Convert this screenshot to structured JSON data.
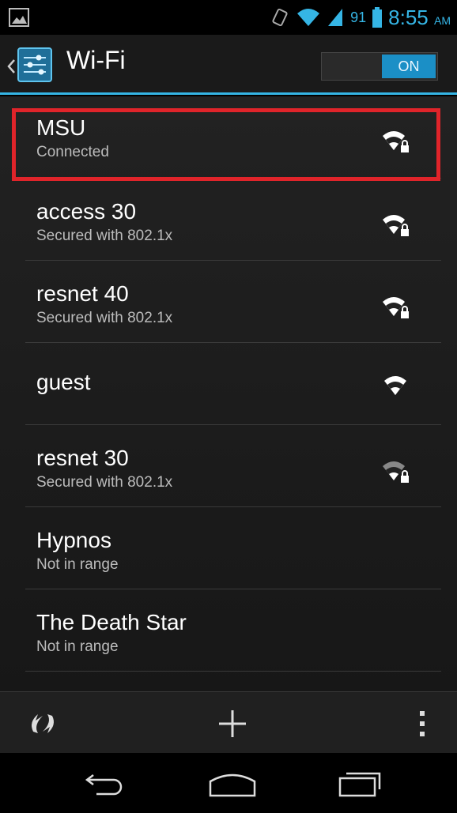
{
  "status_bar": {
    "battery_percent": "91",
    "time": "8:55",
    "ampm": "AM",
    "icons": [
      "gallery-notification-icon",
      "vibrate-icon",
      "wifi-status-icon",
      "signal-icon",
      "battery-icon"
    ]
  },
  "action_bar": {
    "title": "Wi-Fi",
    "toggle_label": "ON",
    "icons": [
      "back-chevron-icon",
      "settings-app-icon"
    ]
  },
  "networks": [
    {
      "ssid": "MSU",
      "status": "Connected",
      "icon": "wifi-secured-icon",
      "highlighted": true
    },
    {
      "ssid": "access 30",
      "status": "Secured with 802.1x",
      "icon": "wifi-secured-icon"
    },
    {
      "ssid": "resnet 40",
      "status": "Secured with 802.1x",
      "icon": "wifi-secured-icon"
    },
    {
      "ssid": "guest",
      "status": "",
      "icon": "wifi-open-icon"
    },
    {
      "ssid": "resnet 30",
      "status": "Secured with 802.1x",
      "icon": "wifi-secured-weak-icon"
    },
    {
      "ssid": "Hypnos",
      "status": "Not in range"
    },
    {
      "ssid": "The Death Star",
      "status": "Not in range"
    }
  ],
  "bottom_bar": {
    "icons": [
      "wps-icon",
      "add-network-icon",
      "overflow-menu-icon"
    ]
  },
  "nav_bar": {
    "icons": [
      "back-icon",
      "home-icon",
      "recent-apps-icon"
    ]
  },
  "colors": {
    "accent": "#35b5e5",
    "toggle_on": "#1b8fc6",
    "highlight": "#e0242a"
  }
}
